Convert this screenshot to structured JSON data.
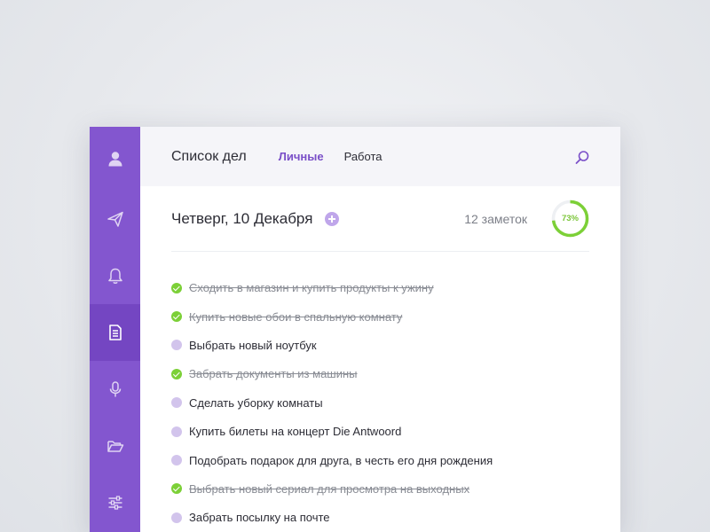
{
  "header": {
    "app_title": "Список дел",
    "tabs": [
      {
        "label": "Личные",
        "active": true
      },
      {
        "label": "Работа",
        "active": false
      }
    ]
  },
  "sidebar": {
    "items": [
      {
        "icon": "user-icon",
        "active": false
      },
      {
        "icon": "send-icon",
        "active": false
      },
      {
        "icon": "bell-icon",
        "active": false
      },
      {
        "icon": "document-icon",
        "active": true
      },
      {
        "icon": "microphone-icon",
        "active": false
      },
      {
        "icon": "folder-icon",
        "active": false
      },
      {
        "icon": "sliders-icon",
        "active": false
      }
    ]
  },
  "day": {
    "title": "Четверг, 10 Декабря",
    "notes_count": "12 заметок",
    "progress_label": "73%",
    "progress_fraction": 0.73
  },
  "tasks": [
    {
      "text": "Сходить в магазин и купить продукты к ужину",
      "done": true
    },
    {
      "text": "Купить новые обои в спальную комнату",
      "done": true
    },
    {
      "text": "Выбрать новый ноутбук",
      "done": false
    },
    {
      "text": "Забрать документы из машины",
      "done": true
    },
    {
      "text": "Сделать уборку комнаты",
      "done": false
    },
    {
      "text": "Купить билеты на концерт Die Antwoord",
      "done": false
    },
    {
      "text": "Подобрать подарок для друга, в честь его дня рождения",
      "done": false
    },
    {
      "text": "Выбрать новый сериал для просмотра на выходных",
      "done": true
    },
    {
      "text": "Забрать посылку на почте",
      "done": false
    }
  ],
  "colors": {
    "sidebar": "#8356cf",
    "sidebar_active": "#7446c2",
    "accent": "#7a4fc8",
    "done": "#7cd037",
    "todo": "#d2c4ec"
  }
}
